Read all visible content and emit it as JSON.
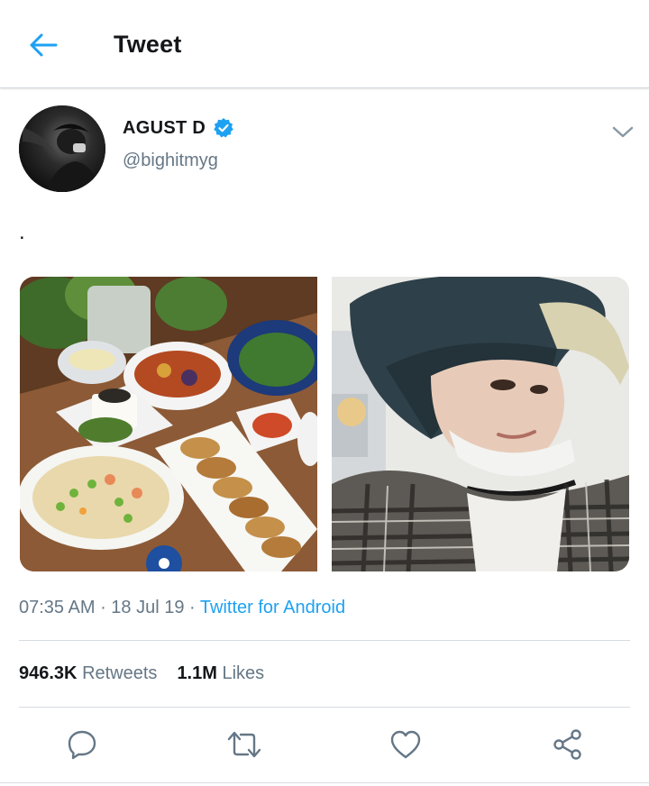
{
  "app_bar": {
    "title": "Tweet"
  },
  "author": {
    "display_name": "AGUST D",
    "handle": "@bighitmyg",
    "verified": true
  },
  "tweet": {
    "text": "."
  },
  "media": [
    {
      "icon": "food-photo"
    },
    {
      "icon": "selfie-photo"
    }
  ],
  "meta": {
    "time": "07:35 AM",
    "separator": " · ",
    "date": "18 Jul 19",
    "source": "Twitter for Android"
  },
  "stats": {
    "retweets": {
      "count": "946.3K",
      "label": "Retweets"
    },
    "likes": {
      "count": "1.1M",
      "label": "Likes"
    }
  },
  "actions": [
    "reply-icon",
    "retweet-icon",
    "like-icon",
    "share-icon"
  ],
  "colors": {
    "accent": "#1da1f2",
    "secondary_text": "#657786",
    "primary_text": "#14171a",
    "divider": "#d5dbe0"
  }
}
